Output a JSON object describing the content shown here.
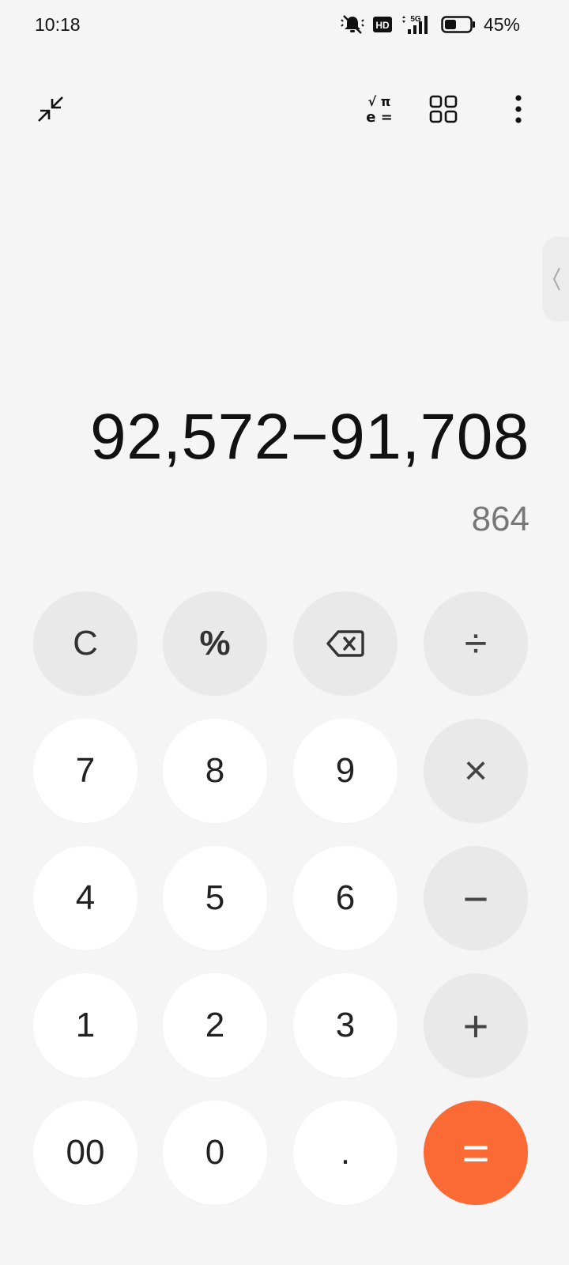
{
  "status_bar": {
    "time": "10:18",
    "hd_label": "HD",
    "network_label": "5G",
    "battery_percent": "45%",
    "battery_level": 0.45
  },
  "toolbar": {
    "scientific_top": "√ π",
    "scientific_bottom": "e ="
  },
  "display": {
    "expression": "92,572−91,708",
    "result": "864"
  },
  "keypad": {
    "clear": "C",
    "percent": "%",
    "divide": "÷",
    "multiply": "×",
    "minus": "−",
    "plus": "+",
    "equals": "=",
    "d7": "7",
    "d8": "8",
    "d9": "9",
    "d4": "4",
    "d5": "5",
    "d6": "6",
    "d1": "1",
    "d2": "2",
    "d3": "3",
    "d00": "00",
    "d0": "0",
    "dot": "."
  },
  "colors": {
    "accent_equals": "#fb6a35",
    "key_function_bg": "#e9e9ea",
    "key_digit_bg": "#ffffff",
    "background": "#f5f5f5"
  },
  "icons": {
    "collapse": "collapse-arrows-icon",
    "scientific": "scientific-mode-icon",
    "grid": "grid-icon",
    "more": "more-vertical-icon",
    "backspace": "backspace-icon",
    "handle": "chevron-left-icon"
  }
}
